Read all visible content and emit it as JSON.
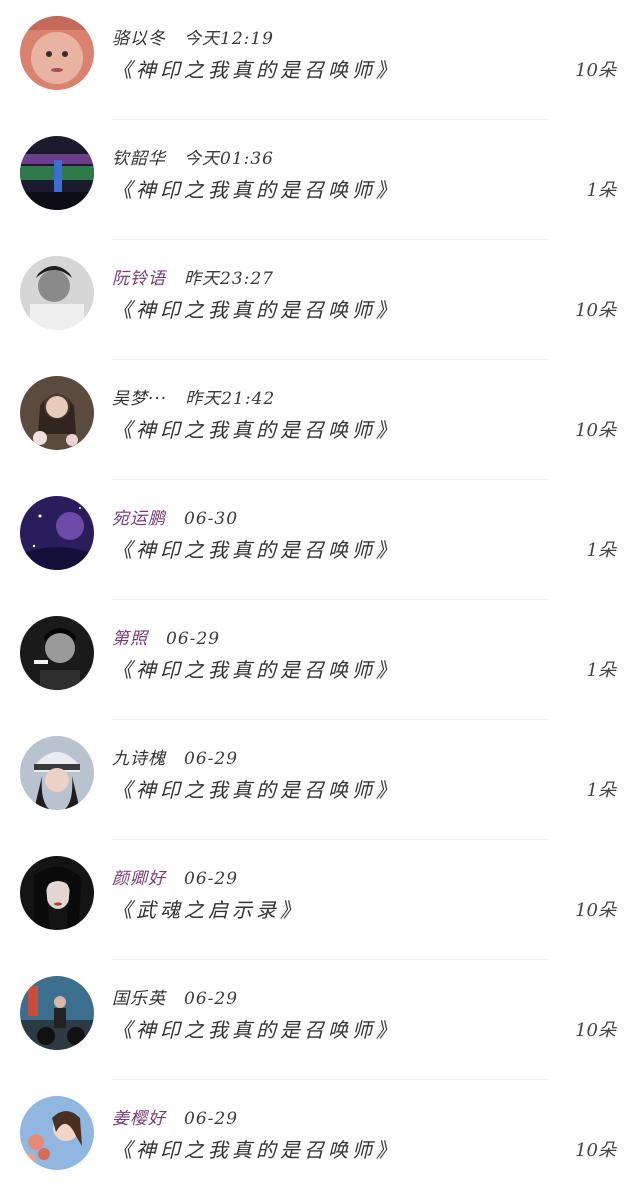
{
  "rows": [
    {
      "name": "骆以冬",
      "time": "今天12:19",
      "title": "《神印之我真的是召唤师》",
      "count": "10朵",
      "name_color": "dark",
      "avatar": "baby-face"
    },
    {
      "name": "钦韶华",
      "time": "今天01:36",
      "title": "《神印之我真的是召唤师》",
      "count": "1朵",
      "name_color": "dark",
      "avatar": "stadium-night"
    },
    {
      "name": "阮铃语",
      "time": "昨天23:27",
      "title": "《神印之我真的是召唤师》",
      "count": "10朵",
      "name_color": "purple",
      "avatar": "boy-bw"
    },
    {
      "name": "吴梦···",
      "time": "昨天21:42",
      "title": "《神印之我真的是召唤师》",
      "count": "10朵",
      "name_color": "dark",
      "avatar": "girl-flowers"
    },
    {
      "name": "宛运鹏",
      "time": "06-30",
      "title": "《神印之我真的是召唤师》",
      "count": "1朵",
      "name_color": "purple",
      "avatar": "galaxy"
    },
    {
      "name": "第照",
      "time": "06-29",
      "title": "《神印之我真的是召唤师》",
      "count": "1朵",
      "name_color": "purple",
      "avatar": "man-smoking"
    },
    {
      "name": "九诗槐",
      "time": "06-29",
      "title": "《神印之我真的是召唤师》",
      "count": "1朵",
      "name_color": "dark",
      "avatar": "girl-helmet"
    },
    {
      "name": "颜卿好",
      "time": "06-29",
      "title": "《武魂之启示录》",
      "count": "10朵",
      "name_color": "purple",
      "avatar": "girl-dark-hair"
    },
    {
      "name": "国乐英",
      "time": "06-29",
      "title": "《神印之我真的是召唤师》",
      "count": "10朵",
      "name_color": "dark",
      "avatar": "street-motorcycle"
    },
    {
      "name": "姜樱好",
      "time": "06-29",
      "title": "《神印之我真的是召唤师》",
      "count": "10朵",
      "name_color": "purple",
      "avatar": "girl-blossom"
    }
  ],
  "colors": {
    "dark": "#333333",
    "purple": "#7a3a78"
  }
}
